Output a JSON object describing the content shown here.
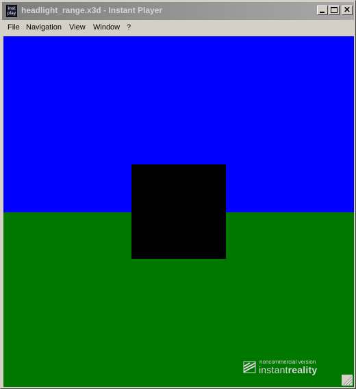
{
  "window": {
    "title": "headlight_range.x3d - Instant Player",
    "icon": "instant-player-icon",
    "icon_text_top": "inst",
    "icon_text_bottom": "play"
  },
  "menu": {
    "items": [
      "File",
      "Navigation",
      "View",
      "Window",
      "?"
    ]
  },
  "scene": {
    "sky_color": "#0000ff",
    "ground_color": "#007800",
    "box_color": "#000000"
  },
  "watermark": {
    "small": "noncommercial version",
    "big_prefix": "instant",
    "big_suffix": "reality"
  }
}
